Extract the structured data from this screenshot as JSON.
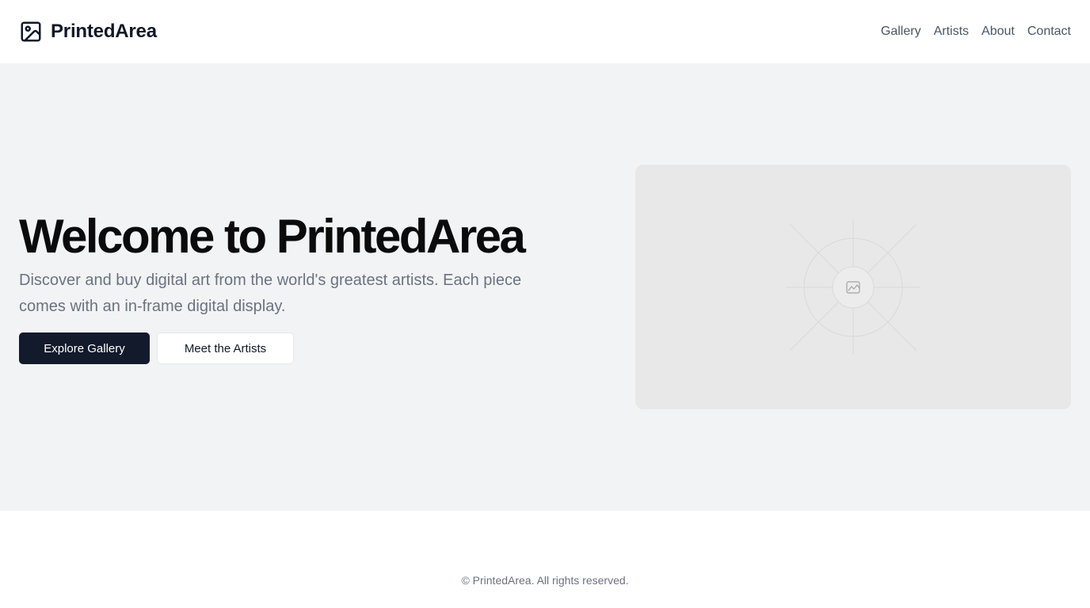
{
  "header": {
    "brand": "PrintedArea",
    "brand_icon": "image-icon",
    "nav": [
      "Gallery",
      "Artists",
      "About",
      "Contact"
    ]
  },
  "hero": {
    "title": "Welcome to PrintedArea",
    "subtitle": "Discover and buy digital art from the world's greatest artists. Each piece comes with an in-frame digital display.",
    "primary_button": "Explore Gallery",
    "secondary_button": "Meet the Artists",
    "image_placeholder_icon": "image-placeholder-icon"
  },
  "footer": {
    "copyright": "© PrintedArea. All rights reserved."
  },
  "colors": {
    "primary_button_bg": "#121a2b",
    "hero_bg": "#f2f3f5",
    "text_dark": "#111827",
    "text_muted": "#6b7280"
  }
}
